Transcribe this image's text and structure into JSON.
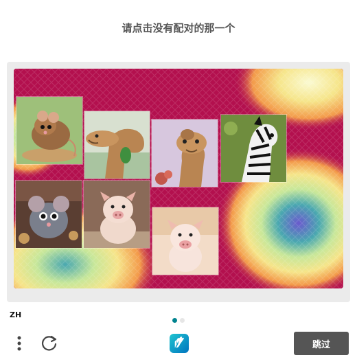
{
  "prompt": {
    "text": "请点击没有配对的那一个"
  },
  "challenge": {
    "tiles": [
      {
        "animal": "mouse"
      },
      {
        "animal": "camel"
      },
      {
        "animal": "camel"
      },
      {
        "animal": "zebra"
      },
      {
        "animal": "mouse"
      },
      {
        "animal": "pig"
      },
      {
        "animal": "pig"
      }
    ]
  },
  "footer": {
    "language": "ZH",
    "pages": {
      "current": 1,
      "total": 2
    },
    "skip_label": "跳过",
    "icons": {
      "menu": "vertical-dots-icon",
      "refresh": "refresh-icon",
      "logo": "hcaptcha-hand-logo"
    }
  },
  "colors": {
    "accent": "#00838f",
    "skip_button": "#555555",
    "prompt_text": "#555555",
    "frame": "#ebebeb"
  }
}
